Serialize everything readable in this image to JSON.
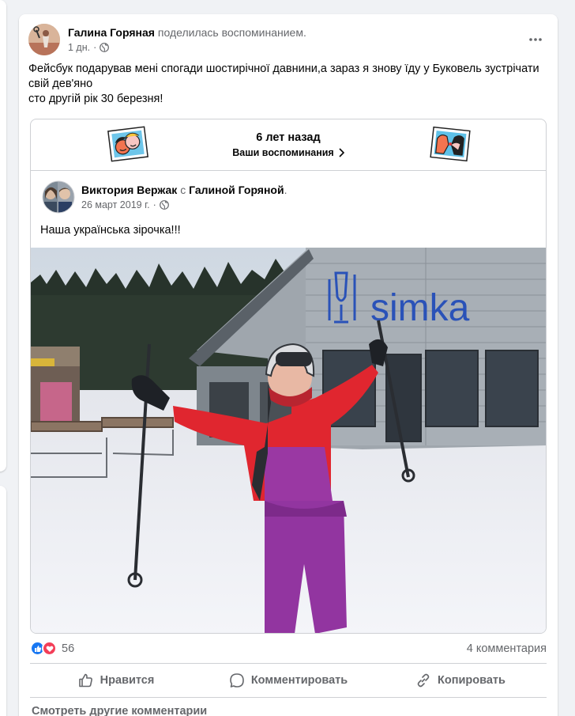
{
  "post": {
    "author": "Галина Горяная",
    "action": "поделилась воспоминанием.",
    "time": "1 дн.",
    "privacy_icon": "globe-icon",
    "text": "Фейсбук подарував мені спогади шостирічної давнини,а зараз  я знову їду у Буковель зустрічати свій  дев'яно\nсто другій рік 30 березня!"
  },
  "memory": {
    "title": "6 лет назад",
    "link": "Ваши воспоминания"
  },
  "shared": {
    "author": "Виктория Вержак",
    "with_word": "с",
    "with_name": "Галиной Горяной",
    "date": "26 март 2019 г.",
    "separator": "·",
    "text": "Наша українська зірочка!!!",
    "photo_sign": "simka"
  },
  "stats": {
    "reaction_count": "56",
    "comments": "4 комментария",
    "reaction_icons": [
      "like-icon",
      "love-icon"
    ]
  },
  "actions": {
    "like": "Нравится",
    "comment": "Комментировать",
    "copy": "Копировать"
  },
  "footer": {
    "more_comments": "Смотреть другие комментарии"
  },
  "colors": {
    "brand_blue": "#1877f2",
    "love_red": "#f33e58",
    "secondary_text": "#65676b"
  }
}
